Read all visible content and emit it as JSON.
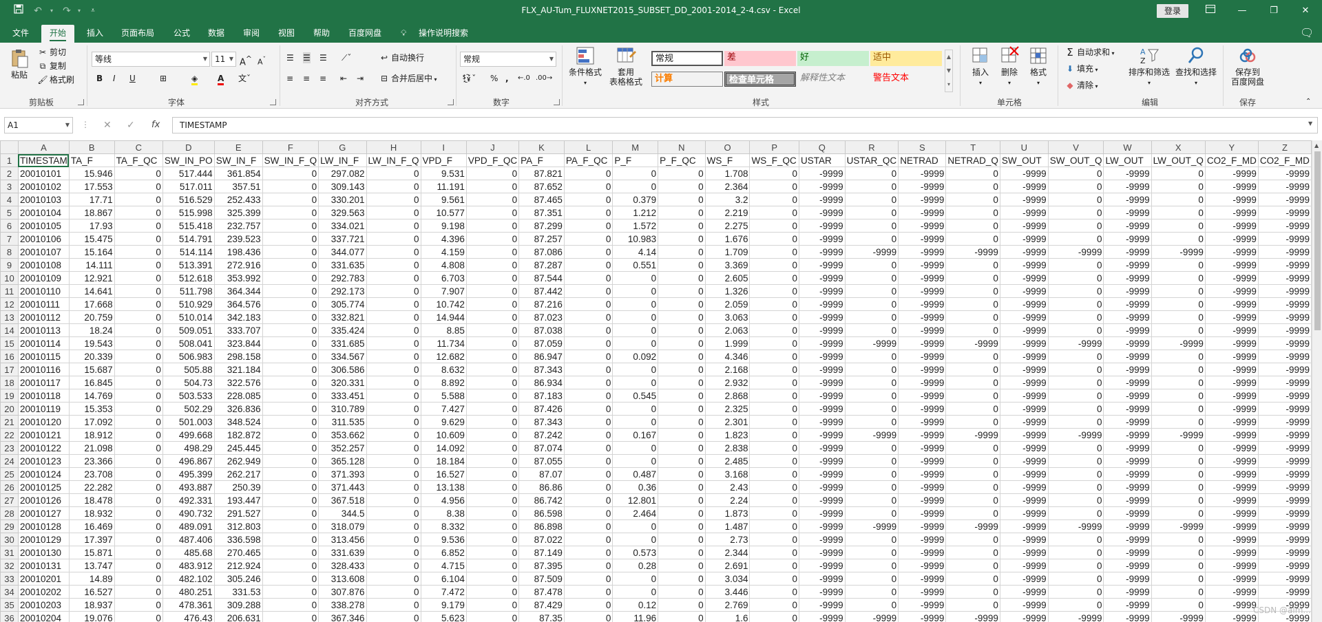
{
  "window": {
    "title": "FLX_AU-Tum_FLUXNET2015_SUBSET_DD_2001-2014_2-4.csv  -  Excel",
    "login_label": "登录"
  },
  "tabs": [
    "文件",
    "开始",
    "插入",
    "页面布局",
    "公式",
    "数据",
    "审阅",
    "视图",
    "帮助",
    "百度网盘"
  ],
  "tell_me": "操作说明搜索",
  "ribbon": {
    "clipboard": {
      "paste": "粘贴",
      "cut": "剪切",
      "copy": "复制",
      "format_painter": "格式刷",
      "label": "剪贴板"
    },
    "font": {
      "name": "等线",
      "size": "11",
      "bold": "B",
      "italic": "I",
      "underline": "U",
      "label": "字体"
    },
    "alignment": {
      "wrap": "自动换行",
      "merge": "合并后居中",
      "label": "对齐方式"
    },
    "number": {
      "format": "常规",
      "label": "数字"
    },
    "styles": {
      "conditional": "条件格式",
      "table_format_1": "套用",
      "table_format_2": "表格格式",
      "normal": "常规",
      "bad": "差",
      "good": "好",
      "neutral": "适中",
      "calc": "计算",
      "check": "检查单元格",
      "explain": "解释性文本",
      "warning": "警告文本",
      "label": "样式"
    },
    "cells": {
      "insert": "插入",
      "delete": "删除",
      "format": "格式",
      "label": "单元格"
    },
    "editing": {
      "autosum": "自动求和",
      "fill": "填充",
      "clear": "清除",
      "sort": "排序和筛选",
      "find": "查找和选择",
      "label": "编辑"
    },
    "save": {
      "line1": "保存到",
      "line2": "百度网盘",
      "label": "保存"
    }
  },
  "formula_bar": {
    "name_box": "A1",
    "content": "TIMESTAMP",
    "fx": "fx"
  },
  "sheet": {
    "column_letters": [
      "A",
      "B",
      "C",
      "D",
      "E",
      "F",
      "G",
      "H",
      "I",
      "J",
      "K",
      "L",
      "M",
      "N",
      "O",
      "P",
      "Q",
      "R",
      "S",
      "T",
      "U",
      "V",
      "W",
      "X",
      "Y",
      "Z"
    ],
    "header_row": [
      "TIMESTAM",
      "TA_F",
      "TA_F_QC",
      "SW_IN_PO",
      "SW_IN_F",
      "SW_IN_F_Q",
      "LW_IN_F",
      "LW_IN_F_Q",
      "VPD_F",
      "VPD_F_QC",
      "PA_F",
      "PA_F_QC",
      "P_F",
      "P_F_QC",
      "WS_F",
      "WS_F_QC",
      "USTAR",
      "USTAR_QC",
      "NETRAD",
      "NETRAD_Q",
      "SW_OUT",
      "SW_OUT_Q",
      "LW_OUT",
      "LW_OUT_Q",
      "CO2_F_MD",
      "CO2_F_MD"
    ],
    "rows": [
      [
        "20010101",
        "15.946",
        "0",
        "517.444",
        "361.854",
        "0",
        "297.082",
        "0",
        "9.531",
        "0",
        "87.821",
        "0",
        "0",
        "0",
        "1.708",
        "0",
        "-9999",
        "0",
        "-9999",
        "0",
        "-9999",
        "0",
        "-9999",
        "0",
        "-9999",
        "-9999"
      ],
      [
        "20010102",
        "17.553",
        "0",
        "517.011",
        "357.51",
        "0",
        "309.143",
        "0",
        "11.191",
        "0",
        "87.652",
        "0",
        "0",
        "0",
        "2.364",
        "0",
        "-9999",
        "0",
        "-9999",
        "0",
        "-9999",
        "0",
        "-9999",
        "0",
        "-9999",
        "-9999"
      ],
      [
        "20010103",
        "17.71",
        "0",
        "516.529",
        "252.433",
        "0",
        "330.201",
        "0",
        "9.561",
        "0",
        "87.465",
        "0",
        "0.379",
        "0",
        "3.2",
        "0",
        "-9999",
        "0",
        "-9999",
        "0",
        "-9999",
        "0",
        "-9999",
        "0",
        "-9999",
        "-9999"
      ],
      [
        "20010104",
        "18.867",
        "0",
        "515.998",
        "325.399",
        "0",
        "329.563",
        "0",
        "10.577",
        "0",
        "87.351",
        "0",
        "1.212",
        "0",
        "2.219",
        "0",
        "-9999",
        "0",
        "-9999",
        "0",
        "-9999",
        "0",
        "-9999",
        "0",
        "-9999",
        "-9999"
      ],
      [
        "20010105",
        "17.93",
        "0",
        "515.418",
        "232.757",
        "0",
        "334.021",
        "0",
        "9.198",
        "0",
        "87.299",
        "0",
        "1.572",
        "0",
        "2.275",
        "0",
        "-9999",
        "0",
        "-9999",
        "0",
        "-9999",
        "0",
        "-9999",
        "0",
        "-9999",
        "-9999"
      ],
      [
        "20010106",
        "15.475",
        "0",
        "514.791",
        "239.523",
        "0",
        "337.721",
        "0",
        "4.396",
        "0",
        "87.257",
        "0",
        "10.983",
        "0",
        "1.676",
        "0",
        "-9999",
        "0",
        "-9999",
        "0",
        "-9999",
        "0",
        "-9999",
        "0",
        "-9999",
        "-9999"
      ],
      [
        "20010107",
        "15.164",
        "0",
        "514.114",
        "198.436",
        "0",
        "344.077",
        "0",
        "4.159",
        "0",
        "87.086",
        "0",
        "4.14",
        "0",
        "1.709",
        "0",
        "-9999",
        "-9999",
        "-9999",
        "-9999",
        "-9999",
        "-9999",
        "-9999",
        "-9999",
        "-9999",
        "-9999"
      ],
      [
        "20010108",
        "14.111",
        "0",
        "513.391",
        "272.916",
        "0",
        "331.635",
        "0",
        "4.808",
        "0",
        "87.287",
        "0",
        "0.551",
        "0",
        "3.369",
        "0",
        "-9999",
        "0",
        "-9999",
        "0",
        "-9999",
        "0",
        "-9999",
        "0",
        "-9999",
        "-9999"
      ],
      [
        "20010109",
        "12.921",
        "0",
        "512.618",
        "353.992",
        "0",
        "292.783",
        "0",
        "6.703",
        "0",
        "87.544",
        "0",
        "0",
        "0",
        "2.605",
        "0",
        "-9999",
        "0",
        "-9999",
        "0",
        "-9999",
        "0",
        "-9999",
        "0",
        "-9999",
        "-9999"
      ],
      [
        "20010110",
        "14.641",
        "0",
        "511.798",
        "364.344",
        "0",
        "292.173",
        "0",
        "7.907",
        "0",
        "87.442",
        "0",
        "0",
        "0",
        "1.326",
        "0",
        "-9999",
        "0",
        "-9999",
        "0",
        "-9999",
        "0",
        "-9999",
        "0",
        "-9999",
        "-9999"
      ],
      [
        "20010111",
        "17.668",
        "0",
        "510.929",
        "364.576",
        "0",
        "305.774",
        "0",
        "10.742",
        "0",
        "87.216",
        "0",
        "0",
        "0",
        "2.059",
        "0",
        "-9999",
        "0",
        "-9999",
        "0",
        "-9999",
        "0",
        "-9999",
        "0",
        "-9999",
        "-9999"
      ],
      [
        "20010112",
        "20.759",
        "0",
        "510.014",
        "342.183",
        "0",
        "332.821",
        "0",
        "14.944",
        "0",
        "87.023",
        "0",
        "0",
        "0",
        "3.063",
        "0",
        "-9999",
        "0",
        "-9999",
        "0",
        "-9999",
        "0",
        "-9999",
        "0",
        "-9999",
        "-9999"
      ],
      [
        "20010113",
        "18.24",
        "0",
        "509.051",
        "333.707",
        "0",
        "335.424",
        "0",
        "8.85",
        "0",
        "87.038",
        "0",
        "0",
        "0",
        "2.063",
        "0",
        "-9999",
        "0",
        "-9999",
        "0",
        "-9999",
        "0",
        "-9999",
        "0",
        "-9999",
        "-9999"
      ],
      [
        "20010114",
        "19.543",
        "0",
        "508.041",
        "323.844",
        "0",
        "331.685",
        "0",
        "11.734",
        "0",
        "87.059",
        "0",
        "0",
        "0",
        "1.999",
        "0",
        "-9999",
        "-9999",
        "-9999",
        "-9999",
        "-9999",
        "-9999",
        "-9999",
        "-9999",
        "-9999",
        "-9999"
      ],
      [
        "20010115",
        "20.339",
        "0",
        "506.983",
        "298.158",
        "0",
        "334.567",
        "0",
        "12.682",
        "0",
        "86.947",
        "0",
        "0.092",
        "0",
        "4.346",
        "0",
        "-9999",
        "0",
        "-9999",
        "0",
        "-9999",
        "0",
        "-9999",
        "0",
        "-9999",
        "-9999"
      ],
      [
        "20010116",
        "15.687",
        "0",
        "505.88",
        "321.184",
        "0",
        "306.586",
        "0",
        "8.632",
        "0",
        "87.343",
        "0",
        "0",
        "0",
        "2.168",
        "0",
        "-9999",
        "0",
        "-9999",
        "0",
        "-9999",
        "0",
        "-9999",
        "0",
        "-9999",
        "-9999"
      ],
      [
        "20010117",
        "16.845",
        "0",
        "504.73",
        "322.576",
        "0",
        "320.331",
        "0",
        "8.892",
        "0",
        "86.934",
        "0",
        "0",
        "0",
        "2.932",
        "0",
        "-9999",
        "0",
        "-9999",
        "0",
        "-9999",
        "0",
        "-9999",
        "0",
        "-9999",
        "-9999"
      ],
      [
        "20010118",
        "14.769",
        "0",
        "503.533",
        "228.085",
        "0",
        "333.451",
        "0",
        "5.588",
        "0",
        "87.183",
        "0",
        "0.545",
        "0",
        "2.868",
        "0",
        "-9999",
        "0",
        "-9999",
        "0",
        "-9999",
        "0",
        "-9999",
        "0",
        "-9999",
        "-9999"
      ],
      [
        "20010119",
        "15.353",
        "0",
        "502.29",
        "326.836",
        "0",
        "310.789",
        "0",
        "7.427",
        "0",
        "87.426",
        "0",
        "0",
        "0",
        "2.325",
        "0",
        "-9999",
        "0",
        "-9999",
        "0",
        "-9999",
        "0",
        "-9999",
        "0",
        "-9999",
        "-9999"
      ],
      [
        "20010120",
        "17.092",
        "0",
        "501.003",
        "348.524",
        "0",
        "311.535",
        "0",
        "9.629",
        "0",
        "87.343",
        "0",
        "0",
        "0",
        "2.301",
        "0",
        "-9999",
        "0",
        "-9999",
        "0",
        "-9999",
        "0",
        "-9999",
        "0",
        "-9999",
        "-9999"
      ],
      [
        "20010121",
        "18.912",
        "0",
        "499.668",
        "182.872",
        "0",
        "353.662",
        "0",
        "10.609",
        "0",
        "87.242",
        "0",
        "0.167",
        "0",
        "1.823",
        "0",
        "-9999",
        "-9999",
        "-9999",
        "-9999",
        "-9999",
        "-9999",
        "-9999",
        "-9999",
        "-9999",
        "-9999"
      ],
      [
        "20010122",
        "21.098",
        "0",
        "498.29",
        "245.445",
        "0",
        "352.257",
        "0",
        "14.092",
        "0",
        "87.074",
        "0",
        "0",
        "0",
        "2.838",
        "0",
        "-9999",
        "0",
        "-9999",
        "0",
        "-9999",
        "0",
        "-9999",
        "0",
        "-9999",
        "-9999"
      ],
      [
        "20010123",
        "23.366",
        "0",
        "496.867",
        "262.949",
        "0",
        "365.128",
        "0",
        "18.184",
        "0",
        "87.055",
        "0",
        "0",
        "0",
        "2.485",
        "0",
        "-9999",
        "0",
        "-9999",
        "0",
        "-9999",
        "0",
        "-9999",
        "0",
        "-9999",
        "-9999"
      ],
      [
        "20010124",
        "23.708",
        "0",
        "495.399",
        "262.217",
        "0",
        "371.393",
        "0",
        "16.527",
        "0",
        "87.07",
        "0",
        "0.487",
        "0",
        "3.168",
        "0",
        "-9999",
        "0",
        "-9999",
        "0",
        "-9999",
        "0",
        "-9999",
        "0",
        "-9999",
        "-9999"
      ],
      [
        "20010125",
        "22.282",
        "0",
        "493.887",
        "250.39",
        "0",
        "371.443",
        "0",
        "13.138",
        "0",
        "86.86",
        "0",
        "0.36",
        "0",
        "2.43",
        "0",
        "-9999",
        "0",
        "-9999",
        "0",
        "-9999",
        "0",
        "-9999",
        "0",
        "-9999",
        "-9999"
      ],
      [
        "20010126",
        "18.478",
        "0",
        "492.331",
        "193.447",
        "0",
        "367.518",
        "0",
        "4.956",
        "0",
        "86.742",
        "0",
        "12.801",
        "0",
        "2.24",
        "0",
        "-9999",
        "0",
        "-9999",
        "0",
        "-9999",
        "0",
        "-9999",
        "0",
        "-9999",
        "-9999"
      ],
      [
        "20010127",
        "18.932",
        "0",
        "490.732",
        "291.527",
        "0",
        "344.5",
        "0",
        "8.38",
        "0",
        "86.598",
        "0",
        "2.464",
        "0",
        "1.873",
        "0",
        "-9999",
        "0",
        "-9999",
        "0",
        "-9999",
        "0",
        "-9999",
        "0",
        "-9999",
        "-9999"
      ],
      [
        "20010128",
        "16.469",
        "0",
        "489.091",
        "312.803",
        "0",
        "318.079",
        "0",
        "8.332",
        "0",
        "86.898",
        "0",
        "0",
        "0",
        "1.487",
        "0",
        "-9999",
        "-9999",
        "-9999",
        "-9999",
        "-9999",
        "-9999",
        "-9999",
        "-9999",
        "-9999",
        "-9999"
      ],
      [
        "20010129",
        "17.397",
        "0",
        "487.406",
        "336.598",
        "0",
        "313.456",
        "0",
        "9.536",
        "0",
        "87.022",
        "0",
        "0",
        "0",
        "2.73",
        "0",
        "-9999",
        "0",
        "-9999",
        "0",
        "-9999",
        "0",
        "-9999",
        "0",
        "-9999",
        "-9999"
      ],
      [
        "20010130",
        "15.871",
        "0",
        "485.68",
        "270.465",
        "0",
        "331.639",
        "0",
        "6.852",
        "0",
        "87.149",
        "0",
        "0.573",
        "0",
        "2.344",
        "0",
        "-9999",
        "0",
        "-9999",
        "0",
        "-9999",
        "0",
        "-9999",
        "0",
        "-9999",
        "-9999"
      ],
      [
        "20010131",
        "13.747",
        "0",
        "483.912",
        "212.924",
        "0",
        "328.433",
        "0",
        "4.715",
        "0",
        "87.395",
        "0",
        "0.28",
        "0",
        "2.691",
        "0",
        "-9999",
        "0",
        "-9999",
        "0",
        "-9999",
        "0",
        "-9999",
        "0",
        "-9999",
        "-9999"
      ],
      [
        "20010201",
        "14.89",
        "0",
        "482.102",
        "305.246",
        "0",
        "313.608",
        "0",
        "6.104",
        "0",
        "87.509",
        "0",
        "0",
        "0",
        "3.034",
        "0",
        "-9999",
        "0",
        "-9999",
        "0",
        "-9999",
        "0",
        "-9999",
        "0",
        "-9999",
        "-9999"
      ],
      [
        "20010202",
        "16.527",
        "0",
        "480.251",
        "331.53",
        "0",
        "307.876",
        "0",
        "7.472",
        "0",
        "87.478",
        "0",
        "0",
        "0",
        "3.446",
        "0",
        "-9999",
        "0",
        "-9999",
        "0",
        "-9999",
        "0",
        "-9999",
        "0",
        "-9999",
        "-9999"
      ],
      [
        "20010203",
        "18.937",
        "0",
        "478.361",
        "309.288",
        "0",
        "338.278",
        "0",
        "9.179",
        "0",
        "87.429",
        "0",
        "0.12",
        "0",
        "2.769",
        "0",
        "-9999",
        "0",
        "-9999",
        "0",
        "-9999",
        "0",
        "-9999",
        "0",
        "-9999",
        "-9999"
      ],
      [
        "20010204",
        "19.076",
        "0",
        "476.43",
        "206.631",
        "0",
        "367.346",
        "0",
        "5.623",
        "0",
        "87.35",
        "0",
        "11.96",
        "0",
        "1.6",
        "0",
        "-9999",
        "-9999",
        "-9999",
        "-9999",
        "-9999",
        "-9999",
        "-9999",
        "-9999",
        "-9999",
        "-9999"
      ]
    ]
  },
  "watermark": "CSDN @alm..."
}
